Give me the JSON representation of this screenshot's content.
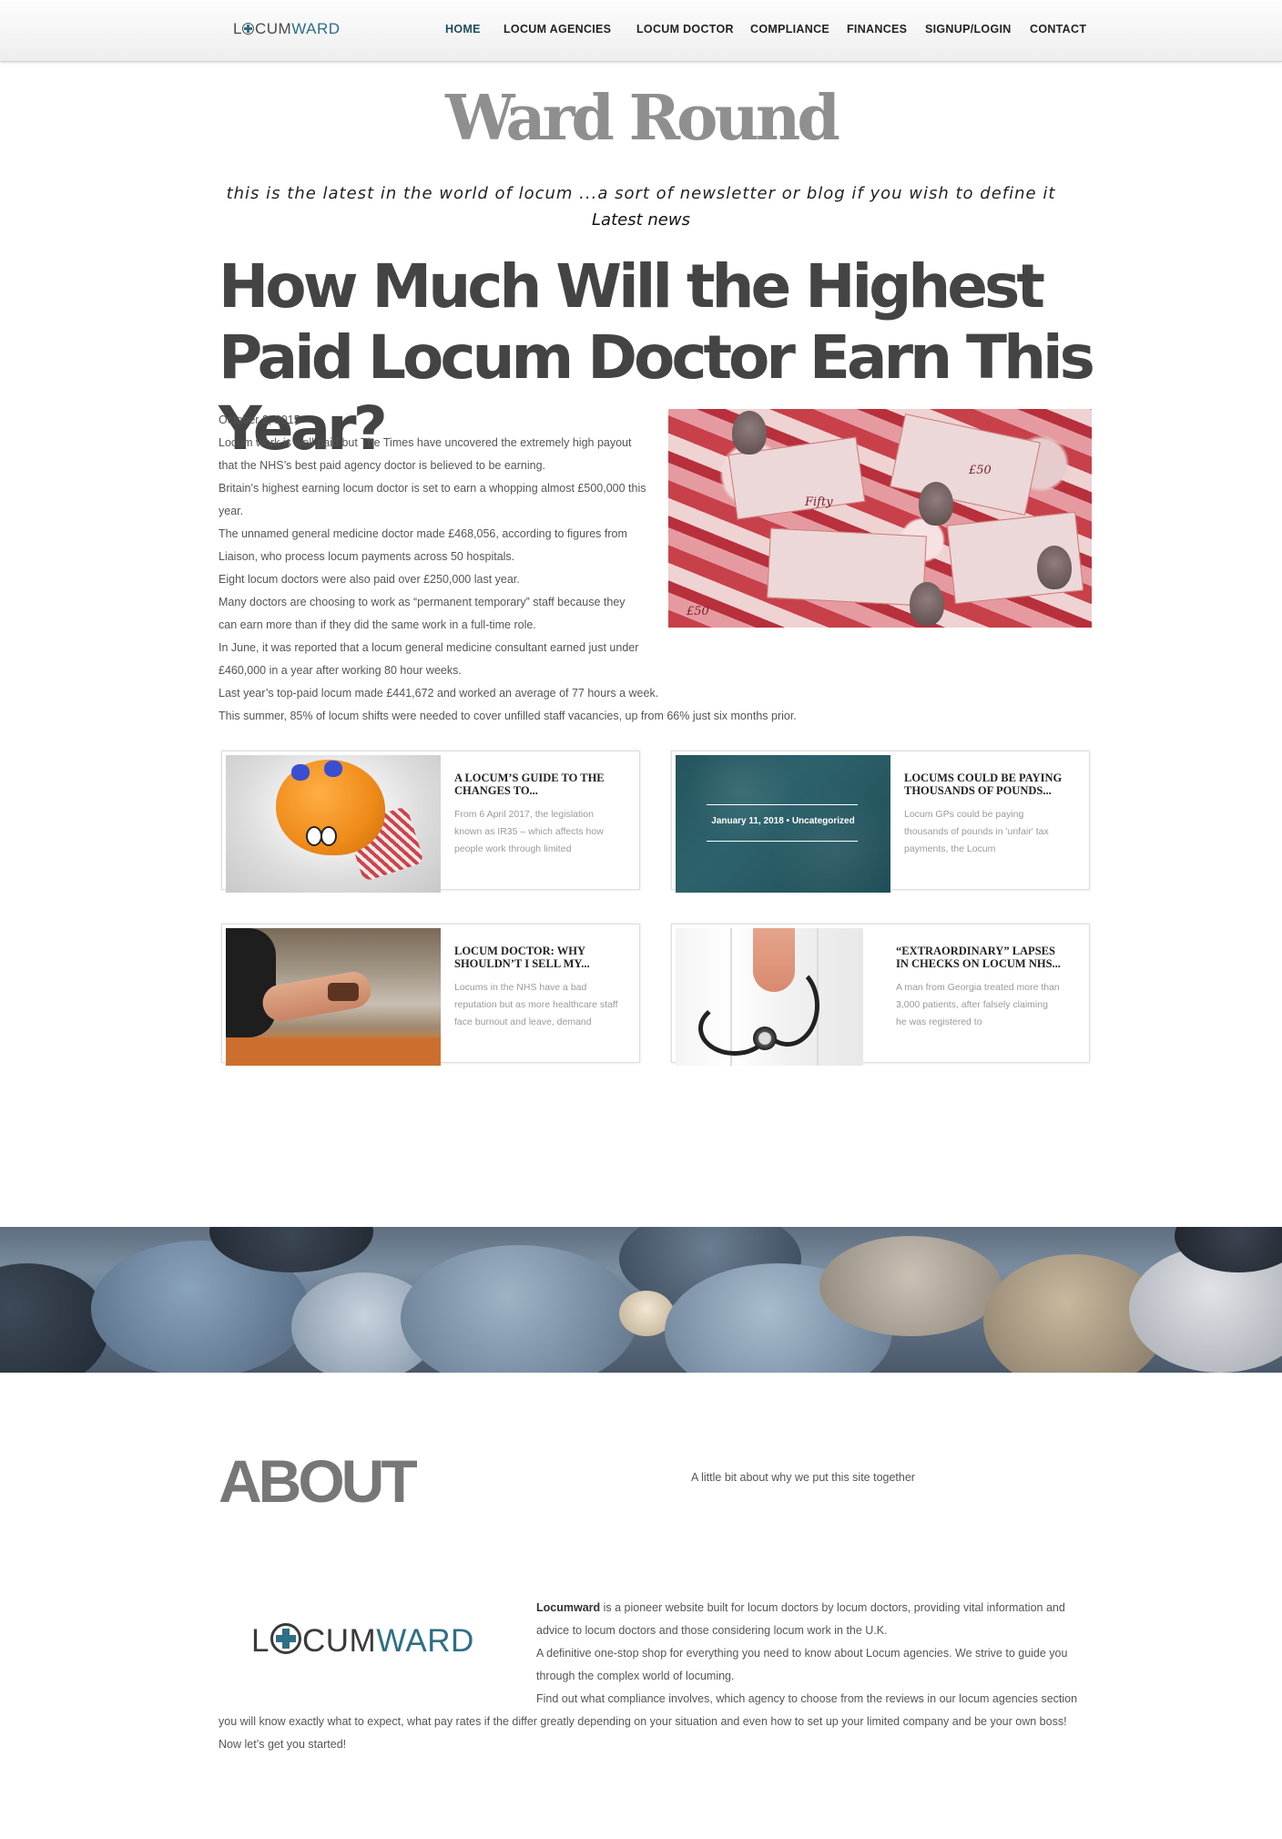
{
  "nav": {
    "logo_part1": "L",
    "logo_part2": "CUM",
    "logo_part3": "WARD",
    "items": [
      "HOME",
      "LOCUM AGENCIES",
      "LOCUM DOCTOR",
      "COMPLIANCE",
      "FINANCES",
      "SIGNUP/LOGIN",
      "CONTACT"
    ]
  },
  "blog": {
    "title": "Ward Round",
    "tagline": "this is the latest in the world of locum ...a sort of newsletter or blog if you wish to define it",
    "latest": "Latest news"
  },
  "article": {
    "headline": "How Much Will the Highest Paid Locum Doctor Earn This Year?",
    "date": "October 2, 2015",
    "paragraphs": [
      "Locum work is well paid but The Times have uncovered the extremely high payout that the NHS’s best paid agency doctor is believed to be earning.",
      "Britain’s highest earning locum doctor is set to earn a whopping almost £500,000 this year.",
      "The unnamed general medicine doctor made £468,056, according to figures from Liaison, who process locum payments across 50 hospitals.",
      "Eight locum doctors were also paid over £250,000 last year.",
      "Many doctors are choosing to work as “permanent temporary” staff because they can earn more than if they did the same work in a full-time role.",
      "In June, it was reported that a locum general medicine consultant earned just under £460,000 in a year after working 80 hour weeks.",
      "Last year’s top-paid locum made £441,672 and worked an average of 77 hours a week.",
      "This summer, 85% of locum shifts were needed to cover unfilled staff vacancies, up from 66% just six months prior."
    ]
  },
  "cards": [
    {
      "title": "A LOCUM’S GUIDE TO THE CHANGES TO...",
      "excerpt": "From 6 April 2017, the legislation known as IR35 – which affects how people work through limited"
    },
    {
      "title": "LOCUMS COULD BE PAYING THOUSANDS OF POUNDS...",
      "excerpt": "Locum GPs could be paying thousands of pounds in 'unfair' tax payments, the Locum",
      "meta": "January 11, 2018 • Uncategorized"
    },
    {
      "title": "LOCUM DOCTOR: WHY SHOULDN’T I SELL MY...",
      "excerpt": "Locums in the NHS have a bad reputation but as more healthcare staff face burnout and leave, demand"
    },
    {
      "title": "“EXTRAORDINARY” LAPSES IN CHECKS ON LOCUM NHS...",
      "excerpt": "A man from Georgia treated more than 3,000 patients, after falsely claiming he was registered to"
    }
  ],
  "about": {
    "title": "ABOUT",
    "subtitle": "A little bit about why we put this site together",
    "logo_part1": "L",
    "logo_part2": "CUM",
    "logo_part3": "WARD",
    "brand": "Locumward",
    "p1_rest": " is a pioneer website built for locum doctors by locum doctors, providing vital information and advice to locum doctors and those considering locum work in the U.K.",
    "p2": "A definitive one-stop shop for everything you need to know about Locum agencies. We strive to guide you through the complex world of locuming.",
    "p3": "Find out what compliance involves, which agency to choose from the reviews in our locum agencies section you will know exactly what to expect, what pay rates if the differ greatly depending on your situation and even how to set up your limited company and be your own boss!",
    "p4": "Now let’s get you started!"
  },
  "colors": {
    "brand_teal": "#2e6f85",
    "card_overlay": "#24555f"
  }
}
